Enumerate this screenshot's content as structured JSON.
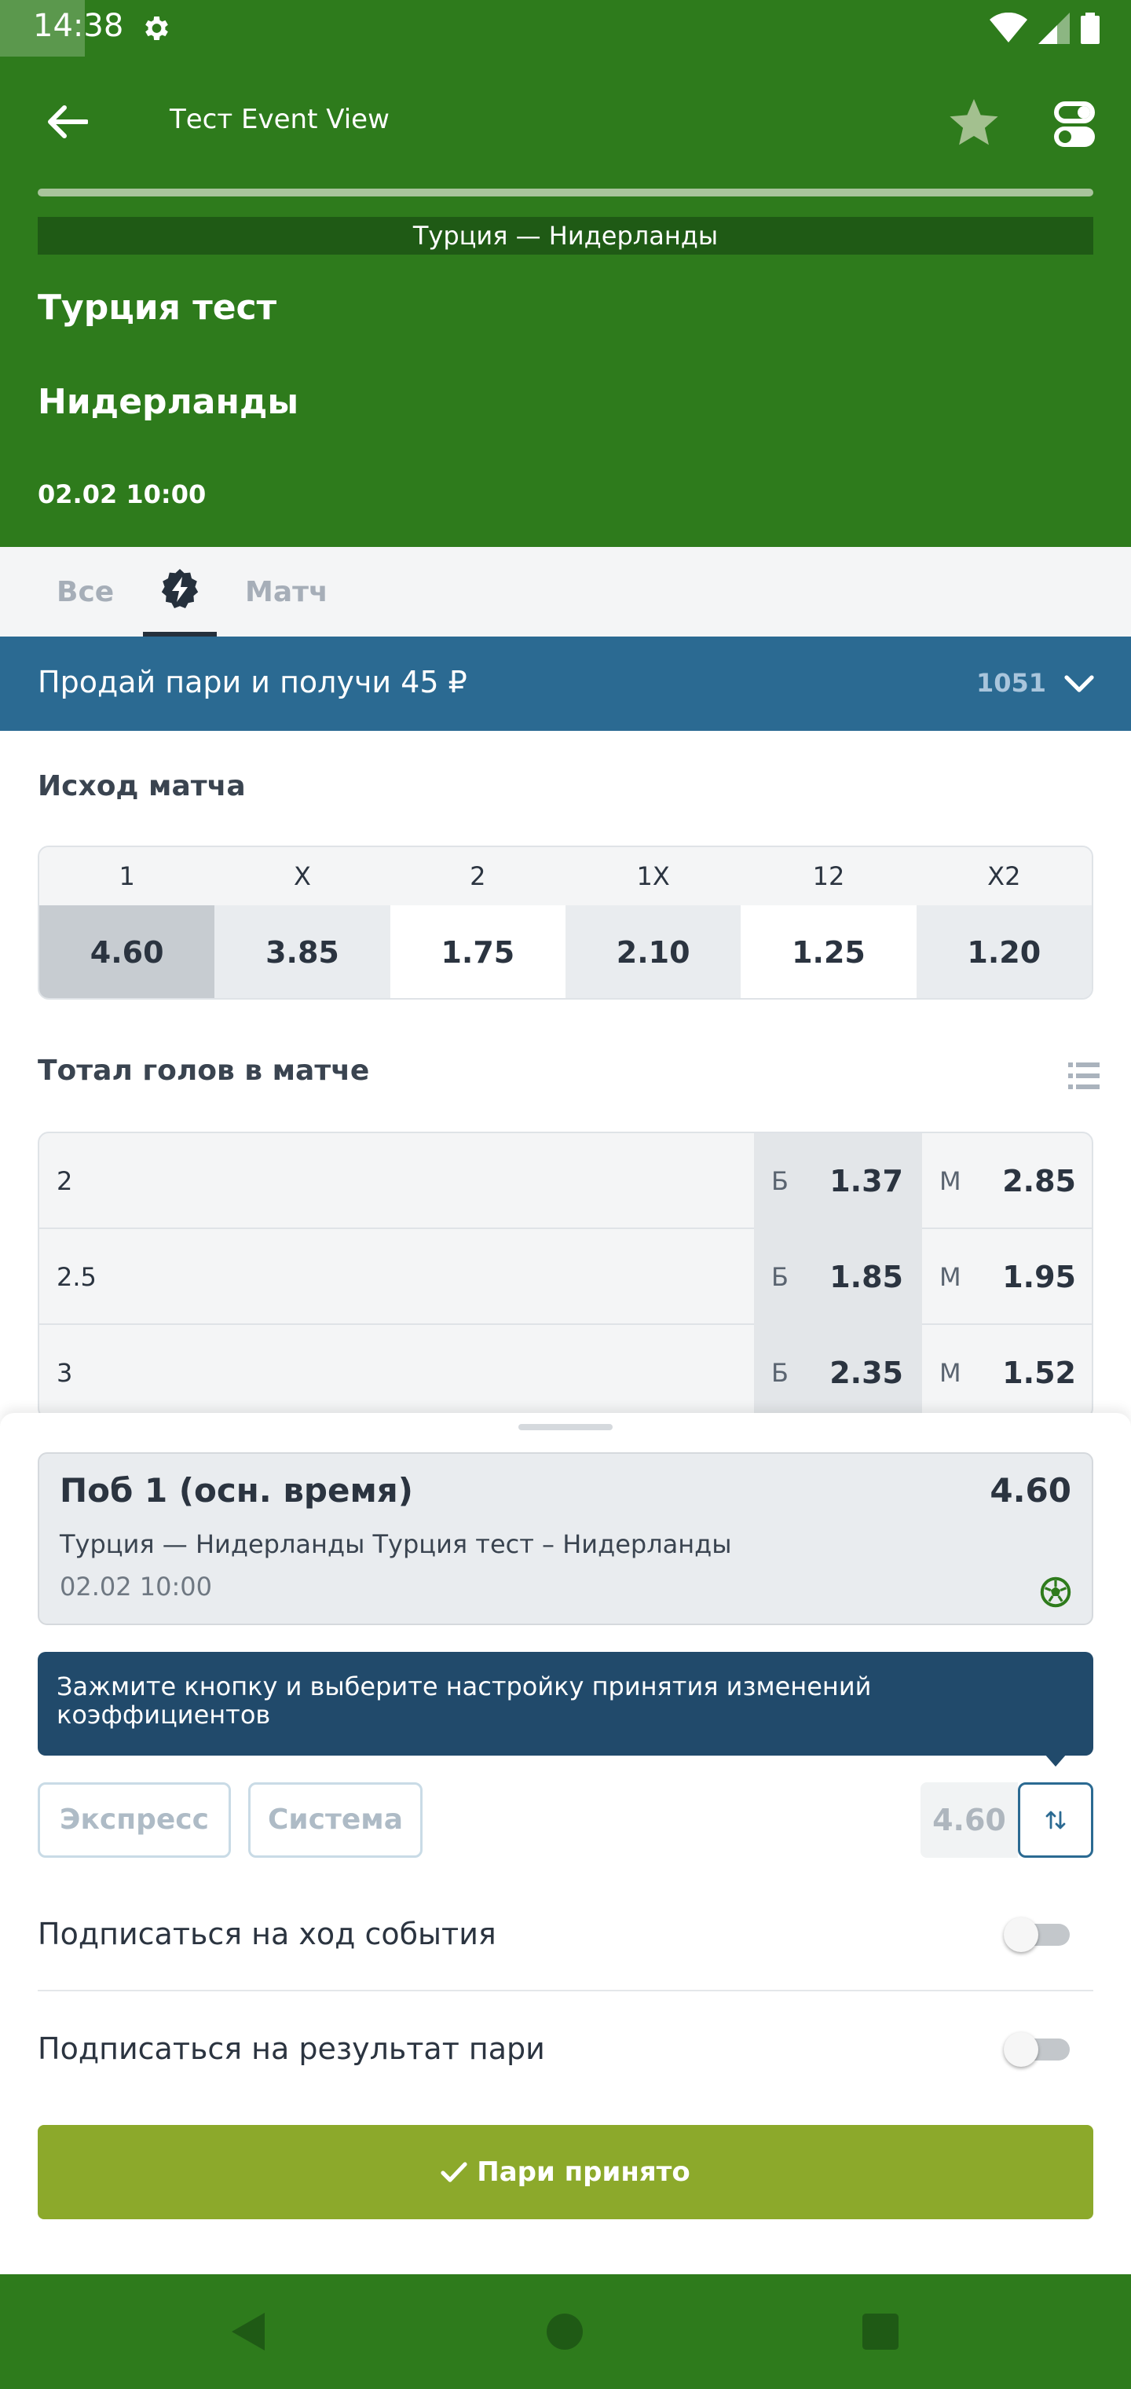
{
  "status_bar": {
    "time": "14:38"
  },
  "header": {
    "title": "Тест Event View"
  },
  "event": {
    "banner": "Турция — Нидерланды",
    "team1": "Турция тест",
    "team2": "Нидерланды",
    "datetime": "02.02 10:00"
  },
  "tabs": [
    {
      "label": "Все"
    },
    {
      "label": "",
      "icon": "lightning-icon"
    },
    {
      "label": "Матч"
    }
  ],
  "promo": {
    "text": "Продай пари и получи 45 ₽",
    "count": "1051"
  },
  "match_result": {
    "title": "Исход матча",
    "outcomes": [
      {
        "label": "1",
        "odd": "4.60",
        "selected": true
      },
      {
        "label": "X",
        "odd": "3.85"
      },
      {
        "label": "2",
        "odd": "1.75"
      },
      {
        "label": "1X",
        "odd": "2.10"
      },
      {
        "label": "12",
        "odd": "1.25"
      },
      {
        "label": "X2",
        "odd": "1.20"
      }
    ]
  },
  "totals": {
    "title": "Тотал голов в матче",
    "rows": [
      {
        "line": "2",
        "over_label": "Б",
        "over_odd": "1.37",
        "under_label": "М",
        "under_odd": "2.85"
      },
      {
        "line": "2.5",
        "over_label": "Б",
        "over_odd": "1.85",
        "under_label": "М",
        "under_odd": "1.95"
      },
      {
        "line": "3",
        "over_label": "Б",
        "over_odd": "2.35",
        "under_label": "М",
        "under_odd": "1.52"
      }
    ]
  },
  "betslip": {
    "bet_title": "Поб 1 (осн. время)",
    "bet_odd": "4.60",
    "bet_event": "Турция — Нидерланды Турция тест – Нидерланды",
    "bet_date": "02.02 10:00",
    "tooltip": "Зажмите кнопку и выберите настройку принятия изменений коэффициентов",
    "express_label": "Экспресс",
    "system_label": "Система",
    "total_odd": "4.60",
    "subscribe_event": "Подписаться на ход события",
    "subscribe_result": "Подписаться на результат пари",
    "accept_label": "Пари принято"
  },
  "colors": {
    "header_green": "#2e7b1c",
    "promo_blue": "#2b6a92",
    "tooltip_blue": "#214a6b",
    "accept_green": "#8ca92b"
  }
}
